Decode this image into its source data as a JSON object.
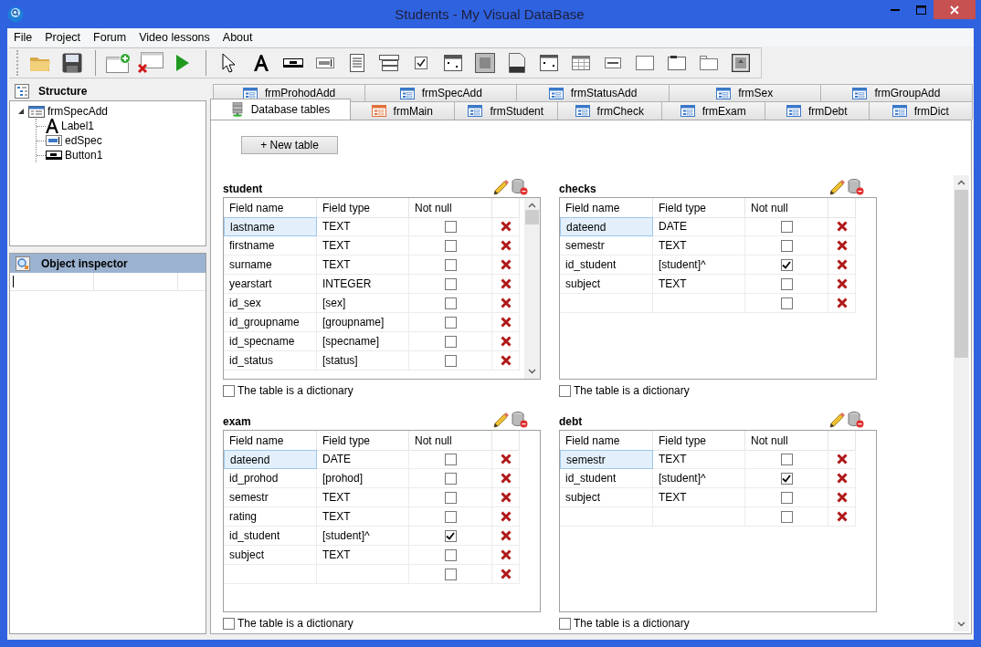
{
  "window": {
    "title": "Students - My Visual DataBase"
  },
  "menu": [
    "File",
    "Project",
    "Forum",
    "Video lessons",
    "About"
  ],
  "structure": {
    "title": "Structure",
    "tree": [
      {
        "label": "frmSpecAdd",
        "kind": "form",
        "expanded": true,
        "children": [
          {
            "label": "Label1",
            "kind": "label"
          },
          {
            "label": "edSpec",
            "kind": "edit"
          },
          {
            "label": "Button1",
            "kind": "button"
          }
        ]
      }
    ]
  },
  "object_inspector": {
    "title": "Object inspector"
  },
  "tabs": {
    "back_row": [
      {
        "label": "frmProhodAdd",
        "kind": "form",
        "selected": false
      },
      {
        "label": "frmSpecAdd",
        "kind": "form",
        "selected": false
      },
      {
        "label": "frmStatusAdd",
        "kind": "form",
        "selected": false
      },
      {
        "label": "frmSex",
        "kind": "form",
        "selected": false
      },
      {
        "label": "frmGroupAdd",
        "kind": "form",
        "selected": false
      }
    ],
    "front_row": [
      {
        "label": "Database tables",
        "kind": "database",
        "selected": true
      },
      {
        "label": "frmMain",
        "kind": "main_form",
        "selected": false
      },
      {
        "label": "frmStudent",
        "kind": "form",
        "selected": false
      },
      {
        "label": "frmCheck",
        "kind": "form",
        "selected": false
      },
      {
        "label": "frmExam",
        "kind": "form",
        "selected": false
      },
      {
        "label": "frmDebt",
        "kind": "form",
        "selected": false
      },
      {
        "label": "frmDict",
        "kind": "form",
        "selected": false
      }
    ]
  },
  "new_table_button": "+ New table",
  "tables": [
    {
      "name": "student",
      "columns": [
        "Field name",
        "Field type",
        "Not null"
      ],
      "scrollbar": true,
      "dictionary_label": "The table is a dictionary",
      "dictionary": false,
      "rows": [
        {
          "field_name": "lastname",
          "field_type": "TEXT",
          "not_null": false,
          "selected": true
        },
        {
          "field_name": "firstname",
          "field_type": "TEXT",
          "not_null": false,
          "selected": false
        },
        {
          "field_name": "surname",
          "field_type": "TEXT",
          "not_null": false,
          "selected": false
        },
        {
          "field_name": "yearstart",
          "field_type": "INTEGER",
          "not_null": false,
          "selected": false
        },
        {
          "field_name": "id_sex",
          "field_type": "[sex]",
          "not_null": false,
          "selected": false
        },
        {
          "field_name": "id_groupname",
          "field_type": "[groupname]",
          "not_null": false,
          "selected": false
        },
        {
          "field_name": "id_specname",
          "field_type": "[specname]",
          "not_null": false,
          "selected": false
        },
        {
          "field_name": "id_status",
          "field_type": "[status]",
          "not_null": false,
          "selected": false
        }
      ]
    },
    {
      "name": "checks",
      "columns": [
        "Field name",
        "Field type",
        "Not null"
      ],
      "scrollbar": false,
      "dictionary_label": "The table is a dictionary",
      "dictionary": false,
      "rows": [
        {
          "field_name": "dateend",
          "field_type": "DATE",
          "not_null": false,
          "selected": true
        },
        {
          "field_name": "semestr",
          "field_type": "TEXT",
          "not_null": false,
          "selected": false
        },
        {
          "field_name": "id_student",
          "field_type": "[student]^",
          "not_null": true,
          "selected": false
        },
        {
          "field_name": "subject",
          "field_type": "TEXT",
          "not_null": false,
          "selected": false
        },
        {
          "not_null": false,
          "selected": false
        }
      ]
    },
    {
      "name": "exam",
      "columns": [
        "Field name",
        "Field type",
        "Not null"
      ],
      "scrollbar": false,
      "dictionary_label": "The table is a dictionary",
      "dictionary": false,
      "rows": [
        {
          "field_name": "dateend",
          "field_type": "DATE",
          "not_null": false,
          "selected": true
        },
        {
          "field_name": "id_prohod",
          "field_type": "[prohod]",
          "not_null": false,
          "selected": false
        },
        {
          "field_name": "semestr",
          "field_type": "TEXT",
          "not_null": false,
          "selected": false
        },
        {
          "field_name": "rating",
          "field_type": "TEXT",
          "not_null": false,
          "selected": false
        },
        {
          "field_name": "id_student",
          "field_type": "[student]^",
          "not_null": true,
          "selected": false
        },
        {
          "field_name": "subject",
          "field_type": "TEXT",
          "not_null": false,
          "selected": false
        },
        {
          "not_null": false,
          "selected": false
        }
      ]
    },
    {
      "name": "debt",
      "columns": [
        "Field name",
        "Field type",
        "Not null"
      ],
      "scrollbar": false,
      "dictionary_label": "The table is a dictionary",
      "dictionary": false,
      "rows": [
        {
          "field_name": "semestr",
          "field_type": "TEXT",
          "not_null": false,
          "selected": true
        },
        {
          "field_name": "id_student",
          "field_type": "[student]^",
          "not_null": true,
          "selected": false
        },
        {
          "field_name": "subject",
          "field_type": "TEXT",
          "not_null": false,
          "selected": false
        },
        {
          "not_null": false,
          "selected": false
        }
      ]
    }
  ]
}
